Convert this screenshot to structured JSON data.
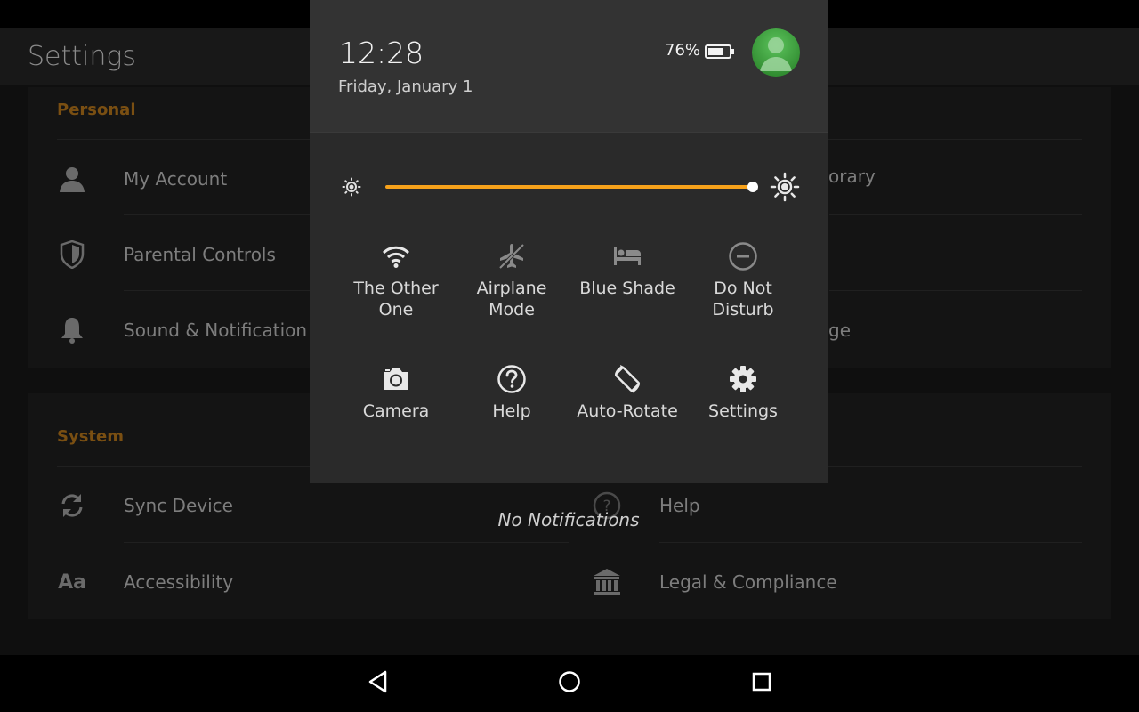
{
  "app": {
    "title": "Settings",
    "sections": {
      "personal": {
        "title": "Personal",
        "left_items": [
          {
            "label": "My Account",
            "icon": "person-icon"
          },
          {
            "label": "Parental Controls",
            "icon": "shield-icon"
          },
          {
            "label": "Sound & Notification",
            "icon": "bell-icon"
          }
        ],
        "right_visible_fragments": [
          "orary",
          "ge"
        ]
      },
      "system": {
        "title": "System",
        "left_items": [
          {
            "label": "Sync Device",
            "icon": "sync-icon"
          },
          {
            "label": "Accessibility",
            "icon": "text-size-icon",
            "icon_text": "Aa"
          }
        ],
        "right_items": [
          {
            "label": "Help",
            "icon": "help-icon"
          },
          {
            "label": "Legal & Compliance",
            "icon": "bank-icon"
          }
        ]
      }
    }
  },
  "quick_settings": {
    "time": "12:28",
    "date": "Friday, January 1",
    "battery_percent": "76%",
    "battery_level": 0.76,
    "brightness_level": 1.0,
    "accent_color": "#f7a21b",
    "avatar_color": "#3a9a3a",
    "tiles_row1": [
      {
        "label": "The Other\nOne",
        "icon": "wifi-icon"
      },
      {
        "label": "Airplane\nMode",
        "icon": "airplane-off-icon"
      },
      {
        "label": "Blue Shade",
        "icon": "bed-icon"
      },
      {
        "label": "Do Not\nDisturb",
        "icon": "do-not-disturb-icon"
      }
    ],
    "tiles_row2": [
      {
        "label": "Camera",
        "icon": "camera-icon"
      },
      {
        "label": "Help",
        "icon": "help-icon"
      },
      {
        "label": "Auto-Rotate",
        "icon": "rotate-icon"
      },
      {
        "label": "Settings",
        "icon": "gear-icon"
      }
    ]
  },
  "notifications": {
    "empty_text": "No Notifications"
  },
  "nav": {
    "buttons": [
      "back-icon",
      "home-icon",
      "recents-icon"
    ]
  }
}
